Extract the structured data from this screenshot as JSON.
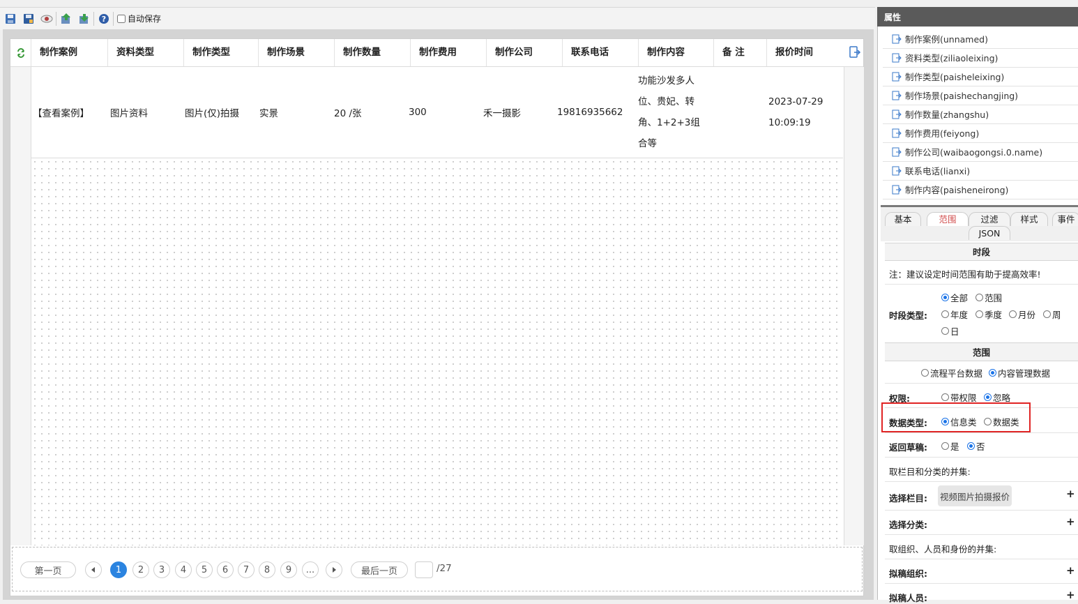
{
  "toolbar": {
    "icons": [
      "save-icon",
      "save-as-icon",
      "preview-icon",
      "import-icon",
      "export-icon",
      "help-icon"
    ],
    "autosave_label": "自动保存",
    "autosave_checked": false
  },
  "table": {
    "headers": [
      "制作案例",
      "资料类型",
      "制作类型",
      "制作场景",
      "制作数量",
      "制作费用",
      "制作公司",
      "联系电话",
      "制作内容",
      "备 注",
      "报价时间"
    ],
    "row": {
      "case": "【查看案例】",
      "material_type": "图片资料",
      "make_type": "图片(仅)拍摄",
      "scene": "实景",
      "quantity": "20 /张",
      "fee": "300",
      "company": "禾一摄影",
      "phone": "19816935662",
      "content_lines": [
        "功能沙发多人",
        "位、贵妃、转",
        "角、1+2+3组",
        "合等"
      ],
      "note": "",
      "date": "2023-07-29",
      "time": "10:09:19"
    }
  },
  "pager": {
    "first": "第一页",
    "last": "最后一页",
    "pages": [
      "1",
      "2",
      "3",
      "4",
      "5",
      "6",
      "7",
      "8",
      "9",
      "..."
    ],
    "current": "1",
    "total": "/27",
    "input_value": ""
  },
  "panel": {
    "title": "属性",
    "fields": [
      "制作案例(unnamed)",
      "资料类型(ziliaoleixing)",
      "制作类型(paisheleixing)",
      "制作场景(paishechangjing)",
      "制作数量(zhangshu)",
      "制作费用(feiyong)",
      "制作公司(waibaogongsi.0.name)",
      "联系电话(lianxi)",
      "制作内容(paisheneirong)"
    ],
    "tabs": [
      "基本",
      "范围",
      "过滤",
      "样式",
      "事件",
      "JSON"
    ],
    "active_tab": "范围",
    "period": {
      "title": "时段",
      "note": "注：建议设定时间范围有助于提高效率!",
      "label": "时段类型:",
      "options": [
        {
          "label": "全部",
          "checked": true
        },
        {
          "label": "范围",
          "checked": false
        },
        {
          "label": "年度",
          "checked": false
        },
        {
          "label": "季度",
          "checked": false
        },
        {
          "label": "月份",
          "checked": false
        },
        {
          "label": "周",
          "checked": false
        },
        {
          "label": "日",
          "checked": false
        }
      ]
    },
    "scope": {
      "title": "范围",
      "source_options": [
        {
          "label": "流程平台数据",
          "checked": false
        },
        {
          "label": "内容管理数据",
          "checked": true
        }
      ],
      "permission_label": "权限:",
      "permission_options": [
        {
          "label": "带权限",
          "checked": false
        },
        {
          "label": "忽略",
          "checked": true
        }
      ],
      "datatype_label": "数据类型:",
      "datatype_options": [
        {
          "label": "信息类",
          "checked": true
        },
        {
          "label": "数据类",
          "checked": false
        }
      ],
      "draft_label": "返回草稿:",
      "draft_options": [
        {
          "label": "是",
          "checked": false
        },
        {
          "label": "否",
          "checked": true
        }
      ],
      "union_note_1": "取栏目和分类的并集:",
      "column_label": "选择栏目:",
      "column_chip": "视频图片拍摄报价",
      "category_label": "选择分类:",
      "union_note_2": "取组织、人员和身份的并集:",
      "draft_org_label": "拟稿组织:",
      "draft_person_label": "拟稿人员:"
    }
  }
}
